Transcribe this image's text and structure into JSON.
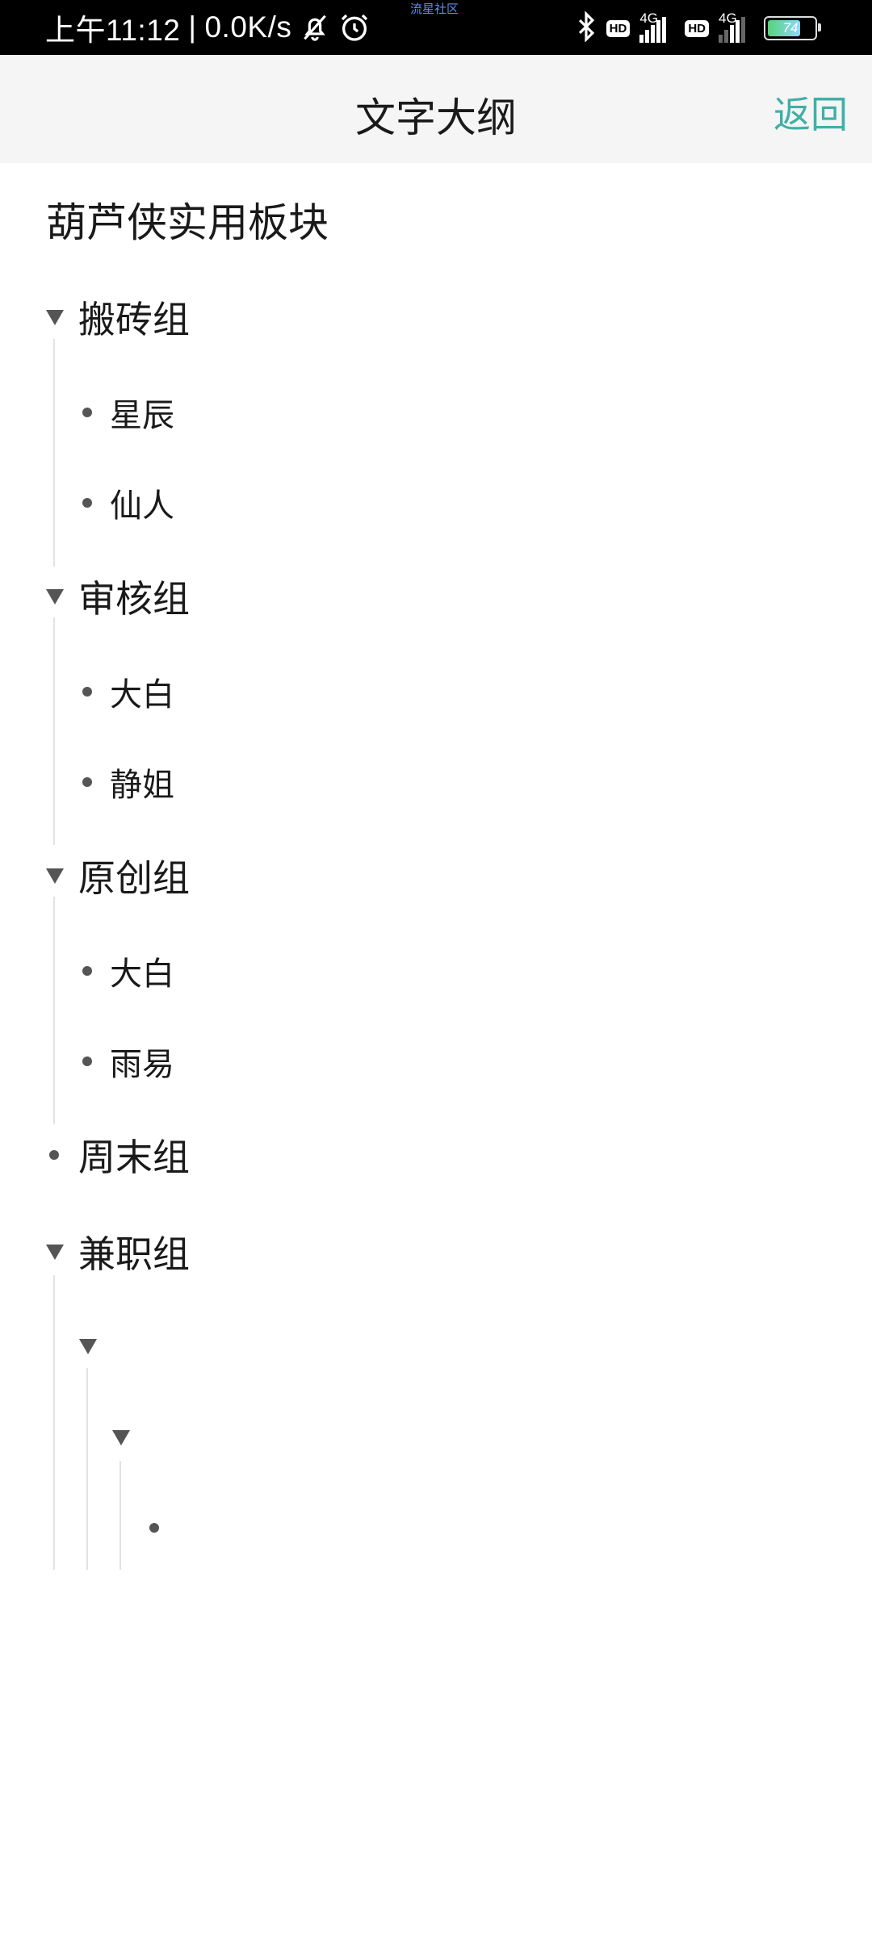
{
  "status_bar": {
    "time": "上午11:12",
    "separator": "|",
    "net_speed": "0.0K/s",
    "center_label": "流星社区",
    "hd1": "HD",
    "net1": "4G",
    "hd2": "HD",
    "net2": "4G",
    "battery": "74",
    "icons": [
      "bell-muted-icon",
      "alarm-icon",
      "bluetooth-icon",
      "signal-icon",
      "battery-icon"
    ]
  },
  "nav": {
    "title": "文字大纲",
    "back_label": "返回",
    "accent_color": "#3fb0a8"
  },
  "outline": {
    "title": "葫芦侠实用板块",
    "groups": [
      {
        "label": "搬砖组",
        "members": [
          {
            "label": "星辰"
          },
          {
            "label": "仙人"
          }
        ]
      },
      {
        "label": "审核组",
        "members": [
          {
            "label": "大白"
          },
          {
            "label": "静姐"
          }
        ]
      },
      {
        "label": "原创组",
        "members": [
          {
            "label": "大白"
          },
          {
            "label": "雨易"
          }
        ]
      },
      {
        "label": "周末组"
      },
      {
        "label": "兼职组"
      }
    ]
  }
}
